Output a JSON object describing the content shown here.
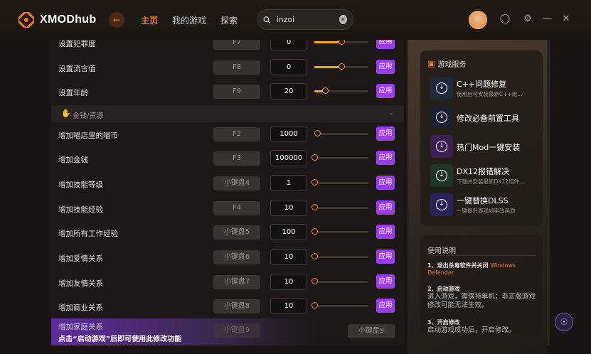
{
  "app": {
    "name": "XMODhub",
    "accent": "#f07b2a",
    "purple": "#9b3cf0"
  },
  "nav": {
    "back_icon": "arrow-left-icon",
    "items": [
      {
        "label": "主页",
        "active": true
      },
      {
        "label": "我的游戏",
        "active": false
      },
      {
        "label": "探索",
        "active": false
      }
    ]
  },
  "search": {
    "value": "inzoi",
    "icon": "search-icon",
    "clear_icon": "close-icon"
  },
  "window_controls": [
    "record-icon",
    "settings-icon",
    "minimize-icon",
    "close-icon"
  ],
  "rows_top": [
    {
      "label": "设置犯罪度",
      "key": "F7",
      "value": "0",
      "level": 0.5,
      "apply": "应用"
    },
    {
      "label": "设置流言值",
      "key": "F8",
      "value": "0",
      "level": 0.5,
      "apply": "应用"
    },
    {
      "label": "设置年龄",
      "key": "F9",
      "value": "20",
      "level": 0.2,
      "apply": "应用"
    }
  ],
  "section": {
    "icon": "hand-icon",
    "title": "金钱/资源"
  },
  "rows_money": [
    {
      "label": "增加喵店里的喵币",
      "key": "F2",
      "value": "1000",
      "level": 0.05,
      "apply": "应用"
    },
    {
      "label": "增加金钱",
      "key": "F3",
      "value": "100000",
      "level": 0,
      "apply": "应用"
    },
    {
      "label": "增加技能等级",
      "key": "小键盘4",
      "value": "1",
      "level": 0,
      "apply": "应用"
    },
    {
      "label": "增加技能经验",
      "key": "F4",
      "value": "10",
      "level": 0,
      "apply": "应用"
    },
    {
      "label": "增加所有工作经验",
      "key": "小键盘5",
      "value": "100",
      "level": 0,
      "apply": "应用"
    },
    {
      "label": "增加爱情关系",
      "key": "小键盘6",
      "value": "10",
      "level": 0,
      "apply": "应用"
    },
    {
      "label": "增加友情关系",
      "key": "小键盘7",
      "value": "10",
      "level": 0,
      "apply": "应用"
    },
    {
      "label": "增加商业关系",
      "key": "小键盘8",
      "value": "10",
      "level": 0,
      "apply": "应用"
    }
  ],
  "banner": {
    "ghost_label": "增加家庭关系",
    "ghost_key": "小键盘9",
    "message": "点击“启动游戏”后即可使用此修改功能",
    "key_label": "小键盘9"
  },
  "services": {
    "title": "游戏服务",
    "items": [
      {
        "title": "C++问题修复",
        "subtitle": "使用后可安装最新C++组...",
        "icon": "download-icon",
        "bg": "#1f2a3a"
      },
      {
        "title": "修改必备前置工具",
        "subtitle": "",
        "icon": "download-icon",
        "bg": "#1a2230"
      },
      {
        "title": "热门Mod一键安装",
        "subtitle": "",
        "icon": "download-icon",
        "bg": "#3a1f55"
      },
      {
        "title": "DX12报错解决",
        "subtitle": "下载并安装最新DX12组件...",
        "icon": "download-icon",
        "bg": "#1f3528"
      },
      {
        "title": "一键替换DLSS",
        "subtitle": "一键提升游戏帧率改画质",
        "icon": "download-icon",
        "bg": "#28245a"
      }
    ]
  },
  "guide": {
    "title": "使用说明",
    "steps": [
      {
        "heading": "1、退出杀毒软件并关闭",
        "highlight": "Windows Defender",
        "body": ""
      },
      {
        "heading": "2、启动游戏",
        "highlight": "",
        "body": "进入游戏，需保持单机；非正版游戏修改可能无法生效。"
      },
      {
        "heading": "3、开启修改",
        "highlight": "",
        "body": "启动游戏成功后，开启修改。"
      }
    ]
  },
  "help_icon": "headset-icon"
}
